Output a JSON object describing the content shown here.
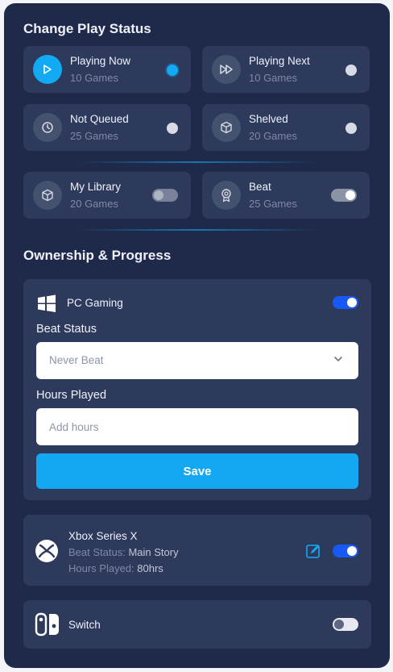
{
  "play_status": {
    "title": "Change Play Status",
    "items": [
      {
        "label": "Playing Now",
        "count": "10 Games",
        "icon": "play-icon",
        "selected": true
      },
      {
        "label": "Playing Next",
        "count": "10 Games",
        "icon": "fast-forward-icon",
        "selected": false
      },
      {
        "label": "Not Queued",
        "count": "25 Games",
        "icon": "clock-icon",
        "selected": false
      },
      {
        "label": "Shelved",
        "count": "20 Games",
        "icon": "box-icon",
        "selected": false
      }
    ],
    "toggles": [
      {
        "label": "My Library",
        "count": "20 Games",
        "icon": "box-icon",
        "on": false
      },
      {
        "label": "Beat",
        "count": "25 Games",
        "icon": "award-icon",
        "on": true
      }
    ]
  },
  "ownership": {
    "title": "Ownership & Progress",
    "pc": {
      "name": "PC Gaming",
      "icon": "windows-icon",
      "enabled": true,
      "beat_status_label": "Beat Status",
      "beat_status_value": "Never Beat",
      "hours_label": "Hours Played",
      "hours_placeholder": "Add hours",
      "save_label": "Save"
    },
    "xbox": {
      "name": "Xbox Series X",
      "icon": "xbox-icon",
      "enabled": true,
      "beat_status_key": "Beat Status:",
      "beat_status_value": "Main Story",
      "hours_key": "Hours Played:",
      "hours_value": "80hrs"
    },
    "switch": {
      "name": "Switch",
      "icon": "nintendo-switch-icon",
      "enabled": false
    }
  },
  "colors": {
    "panel_bg": "#1f2a4a",
    "card_bg": "#2d3a5c",
    "accent": "#13aaf4",
    "toggle_on": "#1659f5"
  }
}
